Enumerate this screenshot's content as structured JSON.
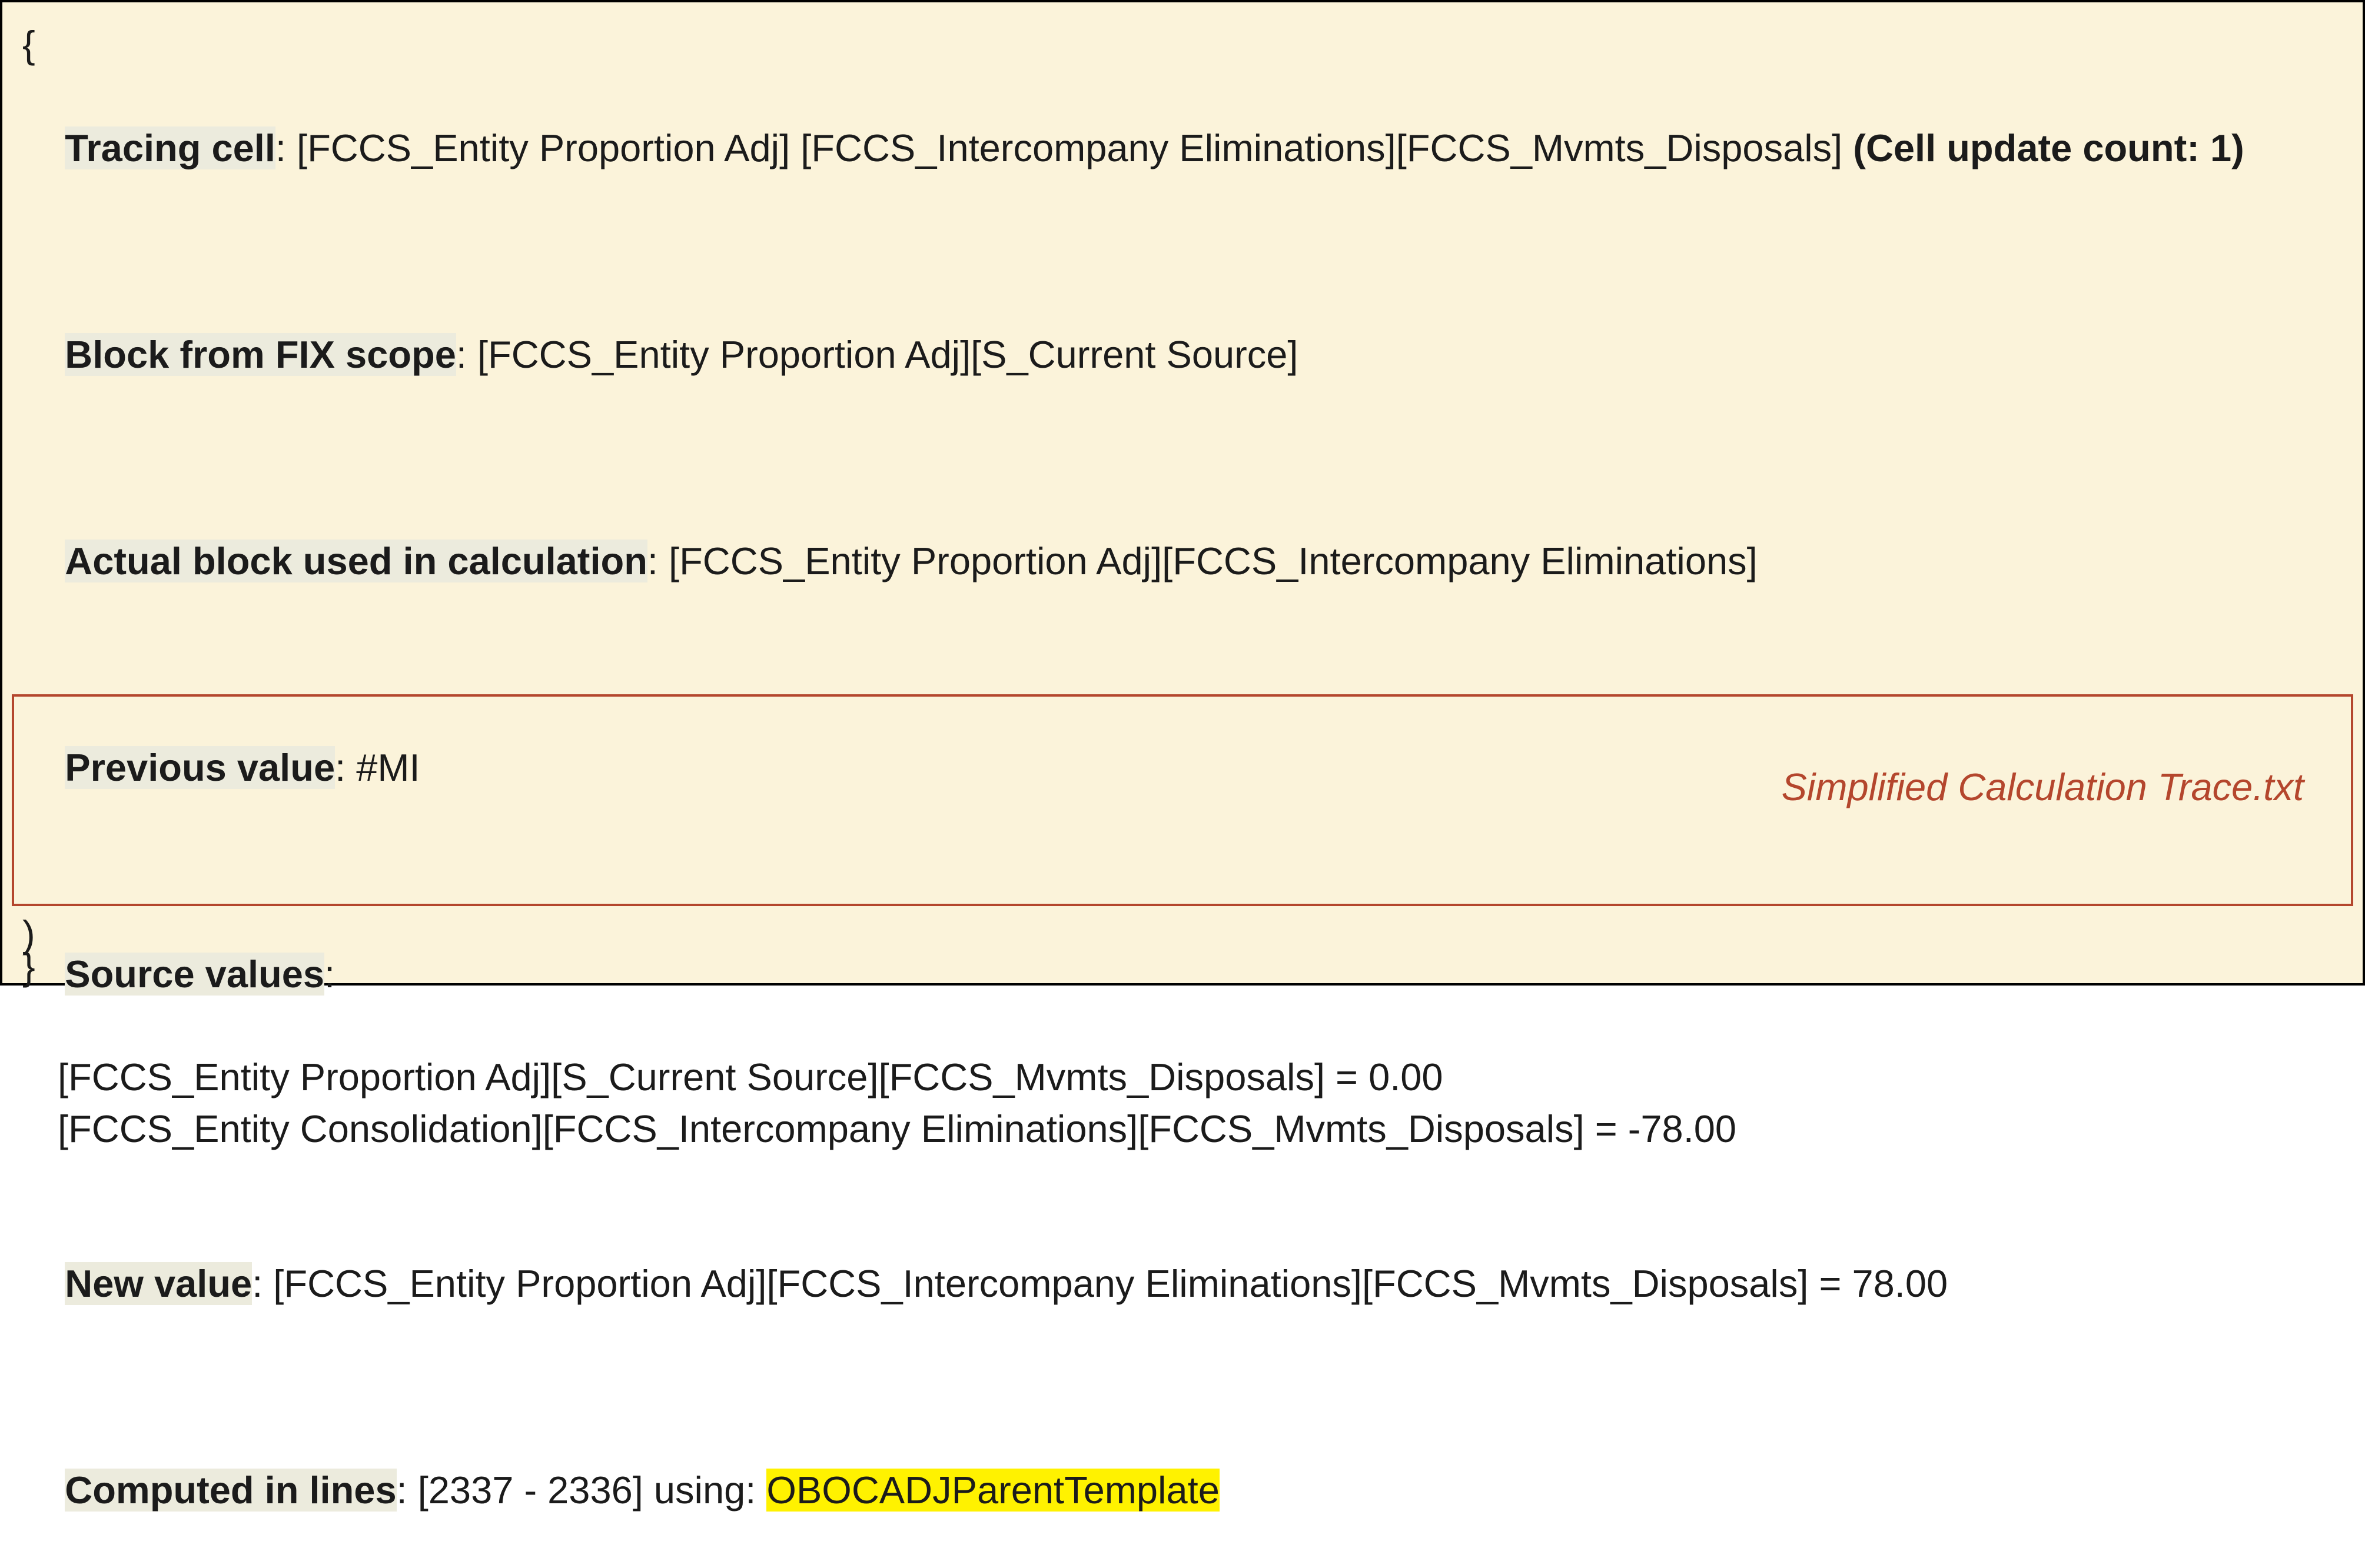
{
  "brace_open": "{",
  "tracing_cell": {
    "label": "Tracing cell",
    "value": ": [FCCS_Entity Proportion Adj] [FCCS_Intercompany Eliminations][FCCS_Mvmts_Disposals] ",
    "count": "(Cell update count: 1)"
  },
  "block_fix": {
    "label": "Block from FIX scope",
    "value": ": [FCCS_Entity Proportion Adj][S_Current Source]"
  },
  "actual_block": {
    "label": "Actual block used in calculation",
    "value": ": [FCCS_Entity Proportion Adj][FCCS_Intercompany Eliminations]"
  },
  "previous_value": {
    "label": "Previous value",
    "value": ": #MI"
  },
  "source_values": {
    "label": "Source values",
    "colon": ":",
    "line1": "[FCCS_Entity Proportion Adj][S_Current Source][FCCS_Mvmts_Disposals] = 0.00",
    "line2": "[FCCS_Entity Consolidation][FCCS_Intercompany Eliminations][FCCS_Mvmts_Disposals] = -78.00"
  },
  "new_value": {
    "label": "New value",
    "value": ": [FCCS_Entity Proportion Adj][FCCS_Intercompany Eliminations][FCCS_Mvmts_Disposals] = 78.00"
  },
  "computed": {
    "label": "Computed in lines",
    "value": ": [2337 - 2336] using: ",
    "template": "OBOCADJParentTemplate"
  },
  "caption": "Simplified Calculation Trace.txt",
  "paren_close": ")",
  "brace_close": "}"
}
